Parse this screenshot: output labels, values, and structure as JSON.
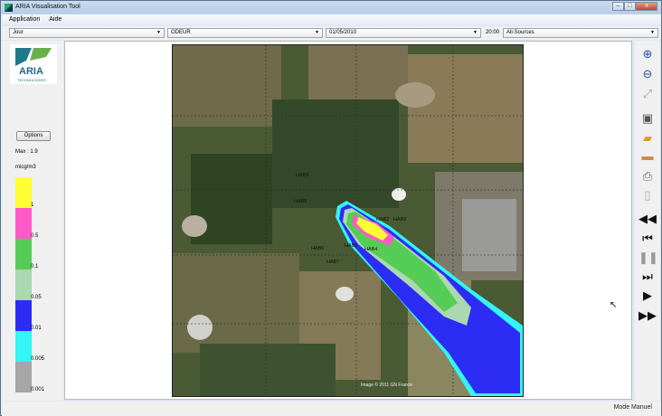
{
  "window": {
    "title": "ARIA Visualisation Tool",
    "minimize": "–",
    "maximize": "□",
    "close": "x"
  },
  "menu": [
    "Application",
    "Aide"
  ],
  "toolbar": {
    "period": "Jour",
    "pollutant": "ODEUR",
    "date": "01/05/2010",
    "time": "20:00",
    "source": "All-Sources"
  },
  "left": {
    "logo_text": "ARIA",
    "logo_sub": "TECHNOLOGIES",
    "options": "Options",
    "max": "Max : 1.9",
    "unit": "micg/m3",
    "legend": [
      {
        "color": "#ffff33",
        "label": "1"
      },
      {
        "color": "#ff5ac8",
        "label": "0.5"
      },
      {
        "color": "#55cc55",
        "label": "0.1"
      },
      {
        "color": "#aad8b0",
        "label": "0.05"
      },
      {
        "color": "#2c2cf5",
        "label": "0.01"
      },
      {
        "color": "#33f5f5",
        "label": "0.005"
      },
      {
        "color": "#a6a6a6",
        "label": "0.001"
      }
    ]
  },
  "map": {
    "labels": [
      "HAB9",
      "HAB8",
      "HAB2",
      "HAB3",
      "HAB6",
      "HAB5",
      "HAB4",
      "HAB7"
    ],
    "credit": "Image © 2011 GN France"
  },
  "status": {
    "mode": "Mode Manuel"
  }
}
